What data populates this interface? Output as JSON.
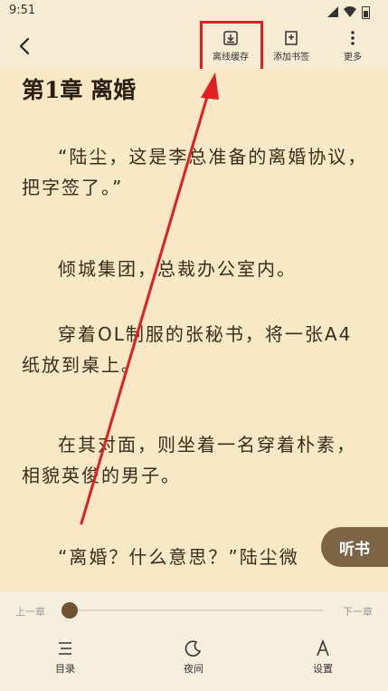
{
  "status": {
    "time": "9:51"
  },
  "toolbar": {
    "offline_cache_label": "离线缓存",
    "add_bookmark_label": "添加书签",
    "more_label": "更多"
  },
  "chapter": {
    "title": "第1章  离婚",
    "paragraphs": [
      "“陆尘，这是李总准备的离婚协议，把字签了。”",
      "倾城集团，总裁办公室内。",
      "穿着OL制服的张秘书，将一张A4纸放到桌上。",
      "在其对面，则坐着一名穿着朴素，相貌英俊的男子。",
      "“离婚？什么意思？”陆尘微"
    ]
  },
  "listen_button": {
    "label": "听书"
  },
  "progress": {
    "prev_label": "上一章",
    "next_label": "下一章",
    "value": 0.0
  },
  "bottom_nav": {
    "catalog_label": "目录",
    "night_label": "夜间",
    "settings_label": "设置"
  },
  "colors": {
    "highlight": "#e02020",
    "content_bg": "#f8e8c6",
    "accent": "#7d6447"
  }
}
